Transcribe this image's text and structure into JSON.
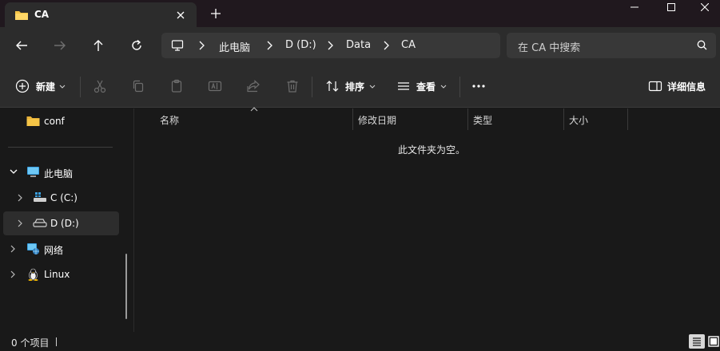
{
  "tab": {
    "title": "CA",
    "close": "✕",
    "new_tab": "+"
  },
  "window": {
    "minimize": "—",
    "maximize": "☐",
    "close": "✕"
  },
  "address": {
    "segments": [
      "此电脑",
      "D (D:)",
      "Data",
      "CA"
    ]
  },
  "search": {
    "placeholder": "在 CA 中搜索"
  },
  "toolbar": {
    "new_label": "新建",
    "sort_label": "排序",
    "view_label": "查看",
    "details_label": "详细信息",
    "more": "···"
  },
  "sidebar": {
    "items": [
      {
        "label": "conf",
        "icon": "folder-icon"
      },
      {
        "label": "此电脑",
        "icon": "computer-icon"
      },
      {
        "label": "C (C:)",
        "icon": "drive-c-icon"
      },
      {
        "label": "D (D:)",
        "icon": "drive-d-icon",
        "selected": true
      },
      {
        "label": "网络",
        "icon": "network-icon"
      },
      {
        "label": "Linux",
        "icon": "linux-icon"
      }
    ]
  },
  "columns": [
    "名称",
    "修改日期",
    "类型",
    "大小"
  ],
  "empty_message": "此文件夹为空。",
  "status": {
    "items_count": "0 个项目"
  },
  "colors": {
    "background": "#191919",
    "toolbar": "#2c2c2c",
    "titlebar": "#20181e",
    "folder": "#f5c446",
    "accent": "#4cc2ff"
  }
}
